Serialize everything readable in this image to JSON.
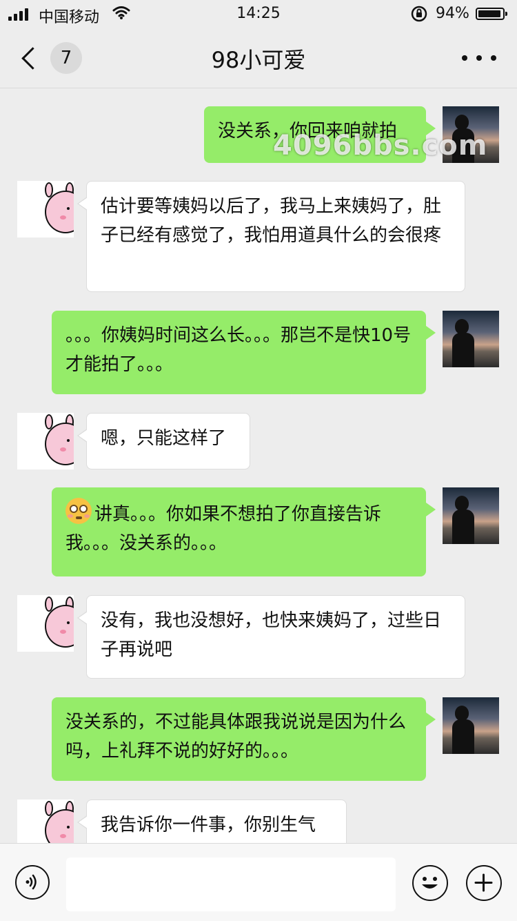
{
  "status_bar": {
    "carrier": "中国移动",
    "time": "14:25",
    "battery_percent": "94%",
    "battery_level": 0.94
  },
  "nav": {
    "unread_count": "7",
    "title": "98小可爱"
  },
  "watermark": "4096bbs.com",
  "messages": [
    {
      "side": "right",
      "text": "没关系，你回来咱就拍"
    },
    {
      "side": "left",
      "text": "估计要等姨妈以后了，我马上来姨妈了，肚子已经有感觉了，我怕用道具什么的会很疼"
    },
    {
      "side": "right",
      "text": "。。。你姨妈时间这么长。。。那岂不是快10号才能拍了。。。"
    },
    {
      "side": "left",
      "text": "嗯，只能这样了"
    },
    {
      "side": "right",
      "emoji": "flushed-face",
      "text": "讲真。。。你如果不想拍了你直接告诉我。。。没关系的。。。"
    },
    {
      "side": "left",
      "text": "没有，我也没想好，也快来姨妈了，过些日子再说吧"
    },
    {
      "side": "right",
      "text": "没关系的，不过能具体跟我说说是因为什么吗，上礼拜不说的好好的。。。"
    },
    {
      "side": "left",
      "text": "我告诉你一件事，你别生气"
    }
  ],
  "input": {
    "value": "",
    "placeholder": ""
  },
  "icons": {
    "voice": "voice-icon",
    "emoji": "emoji-icon",
    "add": "plus-icon"
  },
  "colors": {
    "background": "#ededed",
    "my_bubble": "#95ec69",
    "their_bubble": "#ffffff"
  }
}
